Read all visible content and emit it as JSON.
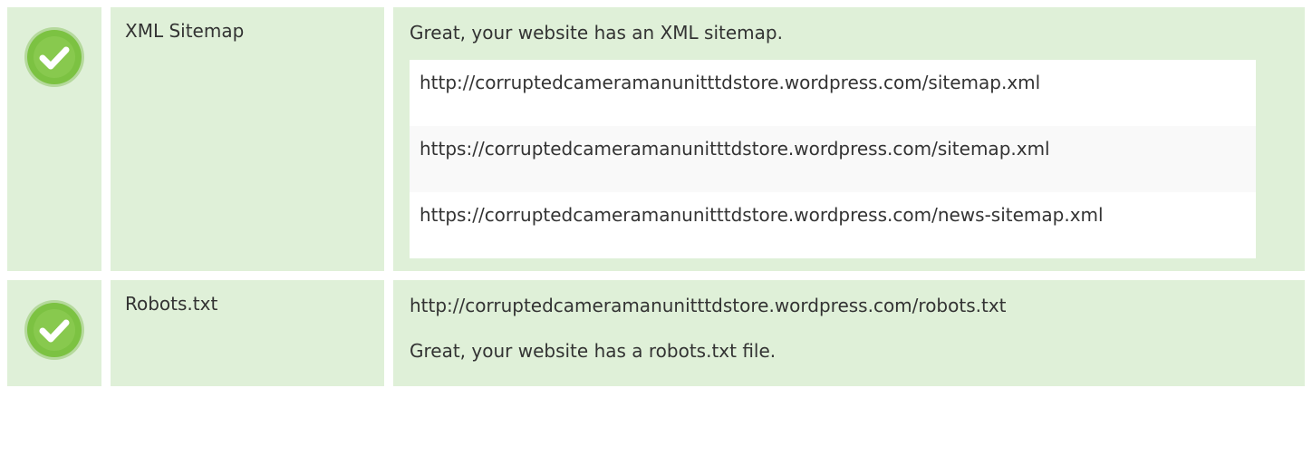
{
  "rows": [
    {
      "name": "XML Sitemap",
      "status": "passed",
      "message": "Great, your website has an XML sitemap.",
      "sitemaps": [
        "http://corruptedcameramanunitttdstore.wordpress.com/sitemap.xml",
        "https://corruptedcameramanunitttdstore.wordpress.com/sitemap.xml",
        "https://corruptedcameramanunitttdstore.wordpress.com/news-sitemap.xml"
      ]
    },
    {
      "name": "Robots.txt",
      "status": "passed",
      "url": "http://corruptedcameramanunitttdstore.wordpress.com/robots.txt",
      "message": "Great, your website has a robots.txt file."
    }
  ],
  "icons": {
    "check": "check-circle-icon"
  },
  "colors": {
    "row_background": "#dff0d8",
    "check_green": "#7cc242",
    "alt_row": "#f9f9f9"
  }
}
